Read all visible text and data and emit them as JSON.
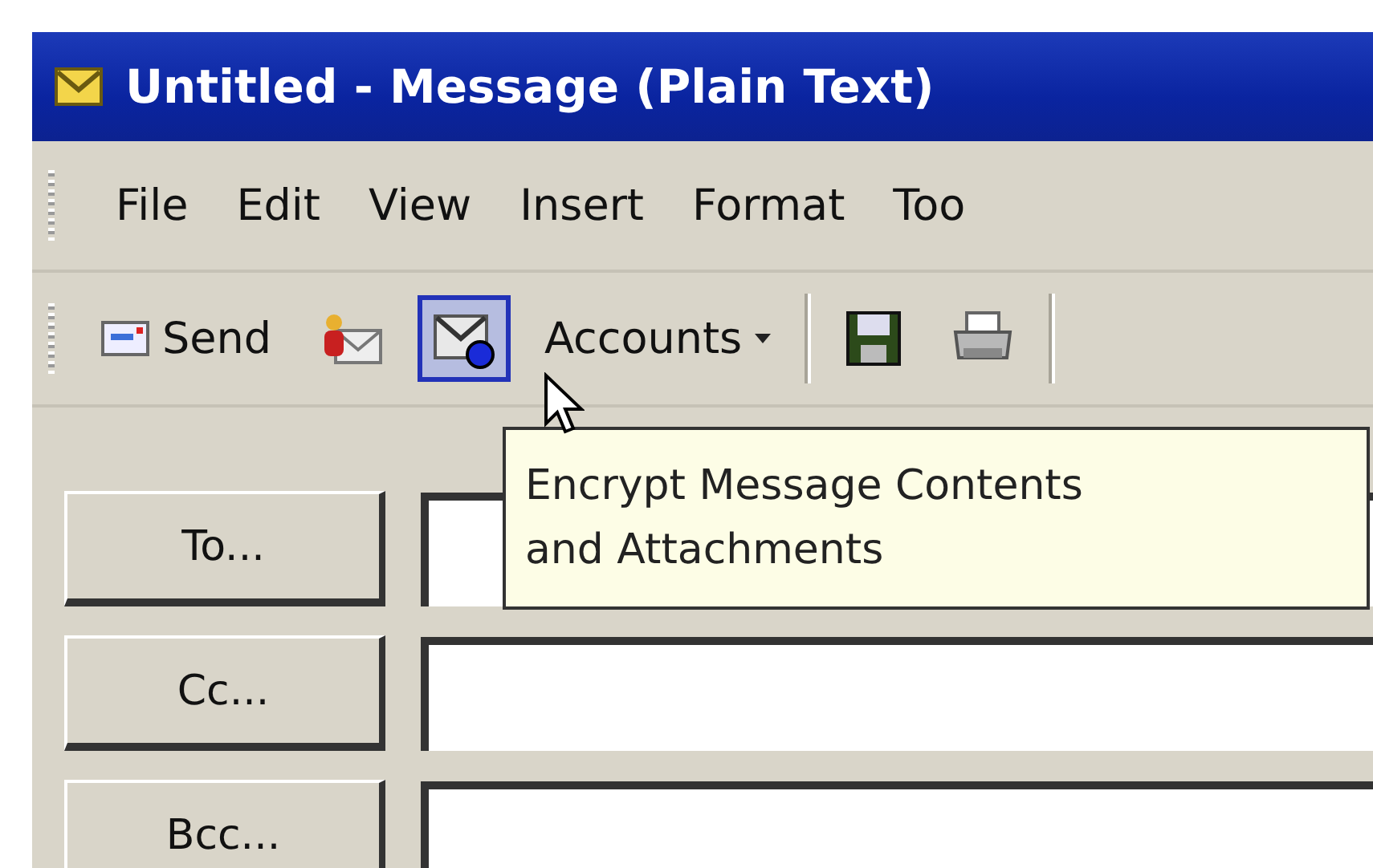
{
  "window": {
    "title": "Untitled - Message (Plain Text)"
  },
  "menu": [
    {
      "label": "File"
    },
    {
      "label": "Edit"
    },
    {
      "label": "View"
    },
    {
      "label": "Insert"
    },
    {
      "label": "Format"
    },
    {
      "label": "Too"
    }
  ],
  "toolbar": [
    {
      "kind": "send",
      "label": "Send",
      "selected": false
    },
    {
      "kind": "address",
      "selected": false
    },
    {
      "kind": "encrypt",
      "selected": true
    },
    {
      "kind": "accounts",
      "label": "Accounts",
      "selected": false
    },
    {
      "kind": "separator"
    },
    {
      "kind": "save",
      "selected": false
    },
    {
      "kind": "print",
      "selected": false
    },
    {
      "kind": "separator"
    }
  ],
  "tooltip": {
    "lines": [
      "Encrypt Message Contents",
      "and Attachments"
    ]
  },
  "address_rows": [
    {
      "button": "To..."
    },
    {
      "button": "Cc..."
    },
    {
      "button": "Bcc..."
    }
  ]
}
